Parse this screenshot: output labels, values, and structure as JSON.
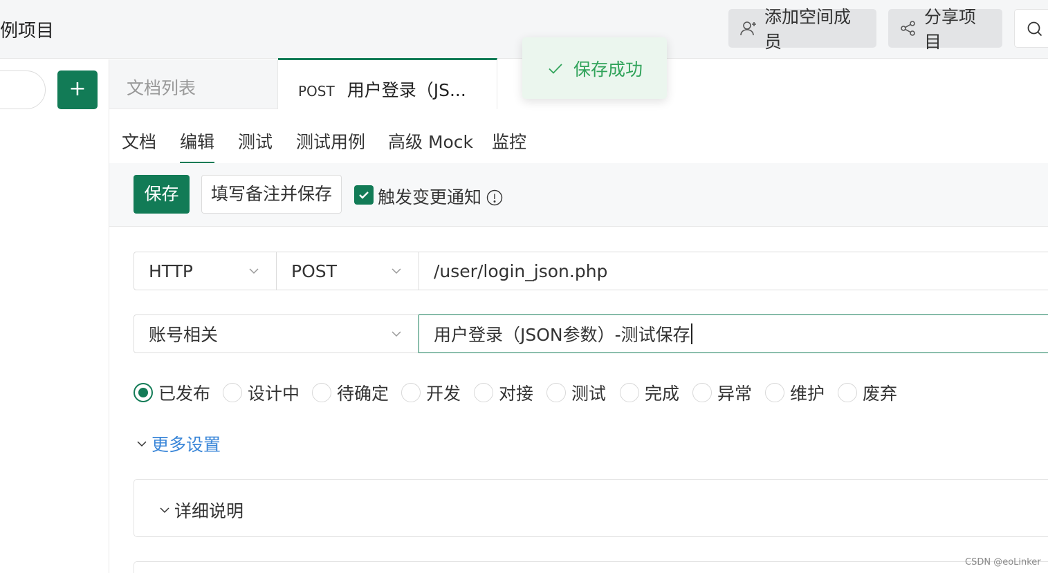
{
  "header": {
    "project_title": "例项目",
    "add_member_label": "添加空间成员",
    "add_member_icon": "user-plus-icon",
    "share_label": "分享项目",
    "share_icon": "share-icon",
    "search_icon": "search-icon"
  },
  "sidebar": {
    "add_icon": "plus-icon",
    "add_symbol": "+"
  },
  "tabs": {
    "doc_list_label": "文档列表",
    "api_tab_method": "POST",
    "api_tab_name": "用户登录（JS..."
  },
  "toast": {
    "message": "保存成功",
    "icon": "check-icon"
  },
  "subtabs": [
    "文档",
    "编辑",
    "测试",
    "测试用例",
    "高级 Mock",
    "监控"
  ],
  "active_subtab": "编辑",
  "actions": {
    "save_label": "保存",
    "save_with_note_label": "填写备注并保存",
    "notify_label": "触发变更通知",
    "notify_checked": true
  },
  "form": {
    "protocol": "HTTP",
    "method": "POST",
    "url": "/user/login_json.php",
    "group": "账号相关",
    "name": "用户登录（JSON参数）-测试保存"
  },
  "status_options": [
    "已发布",
    "设计中",
    "待确定",
    "开发",
    "对接",
    "测试",
    "完成",
    "异常",
    "维护",
    "废弃"
  ],
  "status_selected": "已发布",
  "more_settings_label": "更多设置",
  "detail_section_title": "详细说明",
  "watermark": "CSDN @eoLinker",
  "colors": {
    "primary": "#127b56",
    "link": "#3a86d8",
    "toast_bg": "#ebf6ee",
    "toast_text": "#30a35a"
  }
}
